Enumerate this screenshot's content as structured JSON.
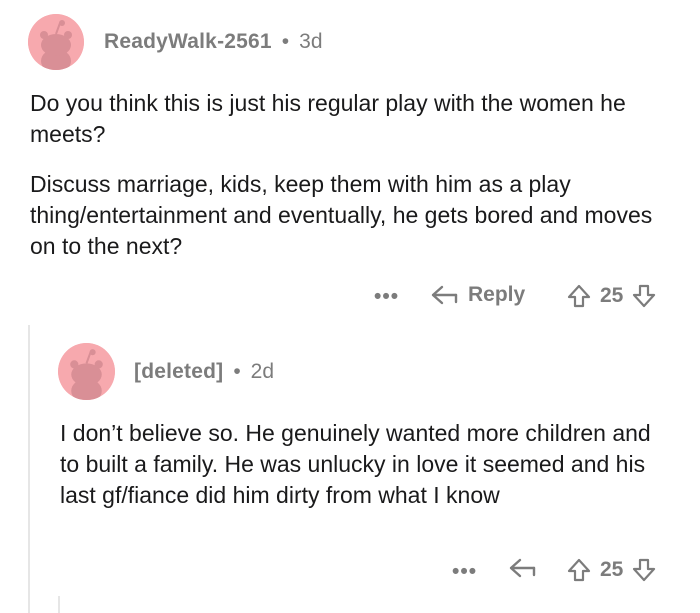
{
  "comment1": {
    "author": "ReadyWalk-2561",
    "separator": "•",
    "age": "3d",
    "paragraphs": [
      "Do you think this is just his regular play with the women he meets?",
      "Discuss marriage, kids, keep them with him as a play thing/entertainment and eventually, he gets bored and moves on to the next?"
    ],
    "actions": {
      "more": "•••",
      "reply_label": "Reply",
      "vote_count": "25"
    }
  },
  "comment2": {
    "author": "[deleted]",
    "separator": "•",
    "age": "2d",
    "paragraphs": [
      "I don’t believe so. He genuinely wanted more children and to built a family. He was unlucky in love it seemed and his last gf/fiance did him dirty from what I know"
    ],
    "actions": {
      "more": "•••",
      "vote_count": "25"
    }
  },
  "colors": {
    "avatar_bg": "#f7a9ae",
    "meta_gray": "#7c7c7c",
    "text": "#1a1a1b"
  }
}
